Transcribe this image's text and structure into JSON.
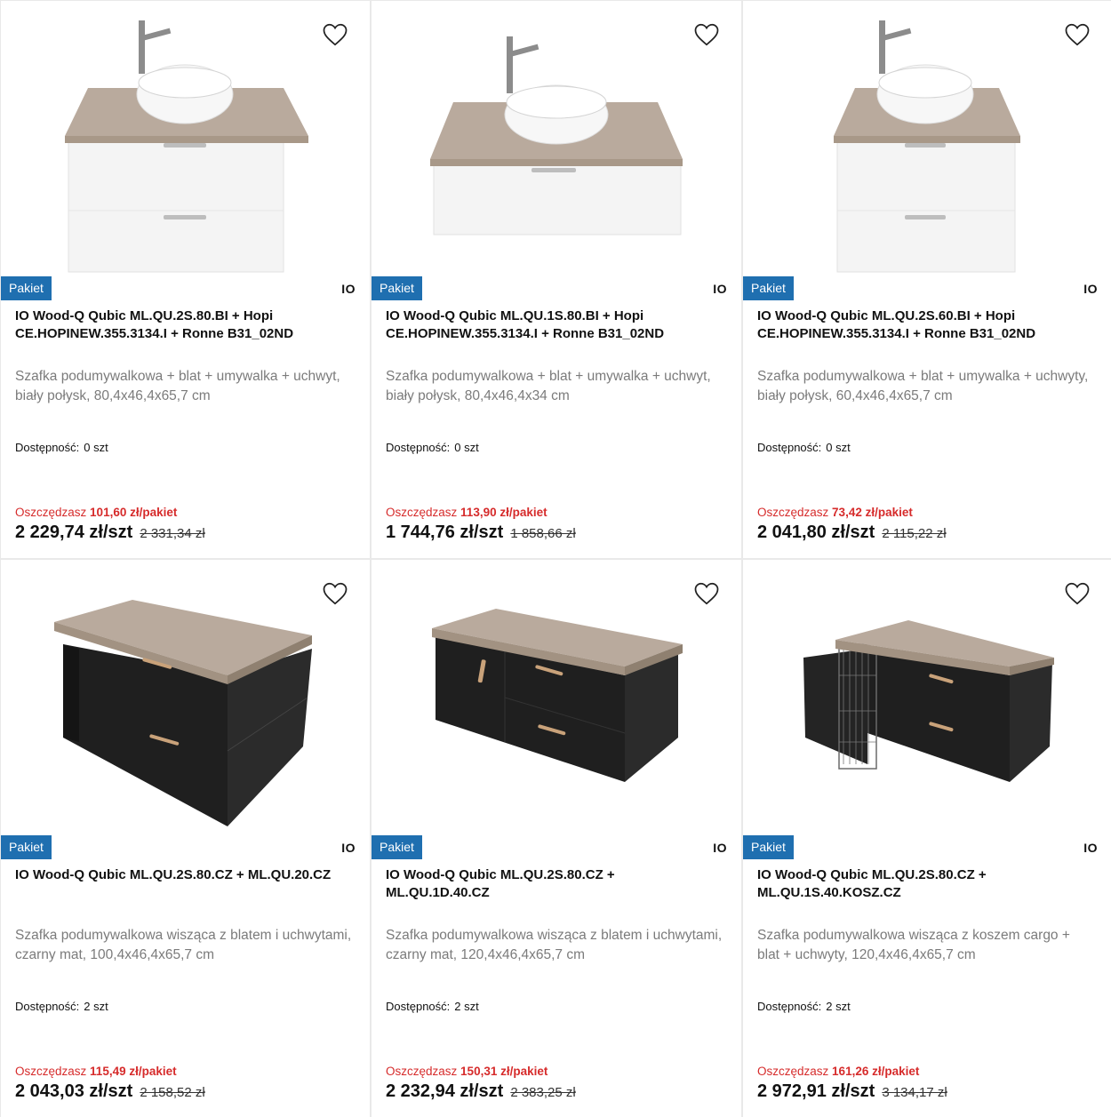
{
  "colors": {
    "badge": "#1f6fb0",
    "savings": "#d62b2b",
    "description": "#7b7b7b"
  },
  "products": [
    {
      "badge": "Pakiet",
      "brand": "IO",
      "title": "IO Wood-Q Qubic ML.QU.2S.80.BI + Hopi CE.HOPINEW.355.3134.I + Ronne B31_02ND",
      "description": "Szafka podumywalkowa + blat + umywalka + uchwyt, biały połysk, 80,4x46,4x65,7 cm",
      "availability_label": "Dostępność:",
      "availability_value": "0 szt",
      "savings_label": "Oszczędzasz",
      "savings_value": "101,60 zł/pakiet",
      "price": "2 229,74 zł/szt",
      "old_price": "2 331,34 zł",
      "image_icon": "white-vanity-with-basin"
    },
    {
      "badge": "Pakiet",
      "brand": "IO",
      "title": "IO Wood-Q Qubic ML.QU.1S.80.BI + Hopi CE.HOPINEW.355.3134.I + Ronne B31_02ND",
      "description": "Szafka podumywalkowa + blat + umywalka + uchwyt, biały połysk, 80,4x46,4x34 cm",
      "availability_label": "Dostępność:",
      "availability_value": "0 szt",
      "savings_label": "Oszczędzasz",
      "savings_value": "113,90 zł/pakiet",
      "price": "1 744,76 zł/szt",
      "old_price": "1 858,66 zł",
      "image_icon": "white-low-vanity-with-basin"
    },
    {
      "badge": "Pakiet",
      "brand": "IO",
      "title": "IO Wood-Q Qubic ML.QU.2S.60.BI + Hopi CE.HOPINEW.355.3134.I + Ronne B31_02ND",
      "description": "Szafka podumywalkowa + blat + umywalka + uchwyty, biały połysk, 60,4x46,4x65,7 cm",
      "availability_label": "Dostępność:",
      "availability_value": "0 szt",
      "savings_label": "Oszczędzasz",
      "savings_value": "73,42 zł/pakiet",
      "price": "2 041,80 zł/szt",
      "old_price": "2 115,22 zł",
      "image_icon": "white-narrow-vanity-with-basin"
    },
    {
      "badge": "Pakiet",
      "brand": "IO",
      "title": "IO Wood-Q Qubic ML.QU.2S.80.CZ + ML.QU.20.CZ",
      "description": "Szafka podumywalkowa wisząca z blatem i uchwytami, czarny mat, 100,4x46,4x65,7 cm",
      "availability_label": "Dostępność:",
      "availability_value": "2 szt",
      "savings_label": "Oszczędzasz",
      "savings_value": "115,49 zł/pakiet",
      "price": "2 043,03 zł/szt",
      "old_price": "2 158,52 zł",
      "image_icon": "black-vanity-with-shelf"
    },
    {
      "badge": "Pakiet",
      "brand": "IO",
      "title": "IO Wood-Q Qubic ML.QU.2S.80.CZ + ML.QU.1D.40.CZ",
      "description": "Szafka podumywalkowa wisząca z blatem i uchwytami, czarny mat, 120,4x46,4x65,7 cm",
      "availability_label": "Dostępność:",
      "availability_value": "2 szt",
      "savings_label": "Oszczędzasz",
      "savings_value": "150,31 zł/pakiet",
      "price": "2 232,94 zł/szt",
      "old_price": "2 383,25 zł",
      "image_icon": "black-vanity-with-door"
    },
    {
      "badge": "Pakiet",
      "brand": "IO",
      "title": "IO Wood-Q Qubic ML.QU.2S.80.CZ + ML.QU.1S.40.KOSZ.CZ",
      "description": "Szafka podumywalkowa wisząca z koszem cargo + blat + uchwyty, 120,4x46,4x65,7 cm",
      "availability_label": "Dostępność:",
      "availability_value": "2 szt",
      "savings_label": "Oszczędzasz",
      "savings_value": "161,26 zł/pakiet",
      "price": "2 972,91 zł/szt",
      "old_price": "3 134,17 zł",
      "image_icon": "black-vanity-with-cargo-basket"
    }
  ]
}
